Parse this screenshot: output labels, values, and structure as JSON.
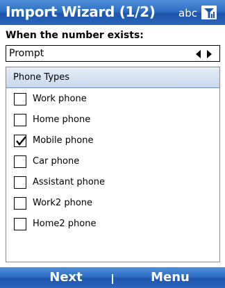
{
  "window": {
    "title": "Import Wizard (1/2)",
    "input_mode": "abc",
    "signal_icon": "signal-strength-icon"
  },
  "duplicate_option": {
    "label": "When the number exists:",
    "selected": "Prompt"
  },
  "phone_types": {
    "header": "Phone Types",
    "items": [
      {
        "label": "Work phone",
        "checked": false
      },
      {
        "label": "Home phone",
        "checked": false
      },
      {
        "label": "Mobile phone",
        "checked": true
      },
      {
        "label": "Car phone",
        "checked": false
      },
      {
        "label": "Assistant phone",
        "checked": false
      },
      {
        "label": "Work2 phone",
        "checked": false
      },
      {
        "label": "Home2 phone",
        "checked": false
      }
    ]
  },
  "softkeys": {
    "left": "Next",
    "right": "Menu"
  },
  "colors": {
    "bar_blue": "#2f6fc4",
    "header_light_blue": "#c8d8ee"
  }
}
